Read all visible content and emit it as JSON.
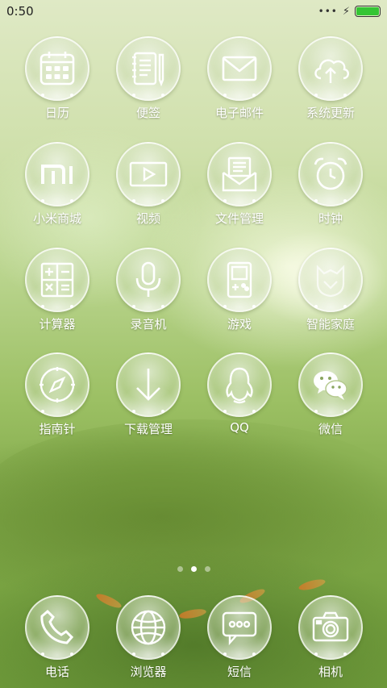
{
  "status_bar": {
    "time": "0:50",
    "more": "•••",
    "charging": "⚡",
    "battery_level": 1.0,
    "battery_color": "#34c534"
  },
  "apps": [
    {
      "label": "日历",
      "icon": "calendar-icon"
    },
    {
      "label": "便签",
      "icon": "notes-icon"
    },
    {
      "label": "电子邮件",
      "icon": "mail-icon"
    },
    {
      "label": "系统更新",
      "icon": "cloud-upload-icon"
    },
    {
      "label": "小米商城",
      "icon": "mi-logo-icon"
    },
    {
      "label": "视频",
      "icon": "video-play-icon"
    },
    {
      "label": "文件管理",
      "icon": "file-manager-icon"
    },
    {
      "label": "时钟",
      "icon": "alarm-clock-icon"
    },
    {
      "label": "计算器",
      "icon": "calculator-icon"
    },
    {
      "label": "录音机",
      "icon": "microphone-icon"
    },
    {
      "label": "游戏",
      "icon": "gameboy-icon"
    },
    {
      "label": "智能家庭",
      "icon": "smart-home-icon"
    },
    {
      "label": "指南针",
      "icon": "compass-icon"
    },
    {
      "label": "下载管理",
      "icon": "download-arrow-icon"
    },
    {
      "label": "QQ",
      "icon": "qq-penguin-icon"
    },
    {
      "label": "微信",
      "icon": "wechat-icon"
    }
  ],
  "page_indicator": {
    "count": 3,
    "active": 2
  },
  "dock": [
    {
      "label": "电话",
      "icon": "phone-icon"
    },
    {
      "label": "浏览器",
      "icon": "globe-icon"
    },
    {
      "label": "短信",
      "icon": "message-bubble-icon"
    },
    {
      "label": "相机",
      "icon": "camera-icon"
    }
  ]
}
